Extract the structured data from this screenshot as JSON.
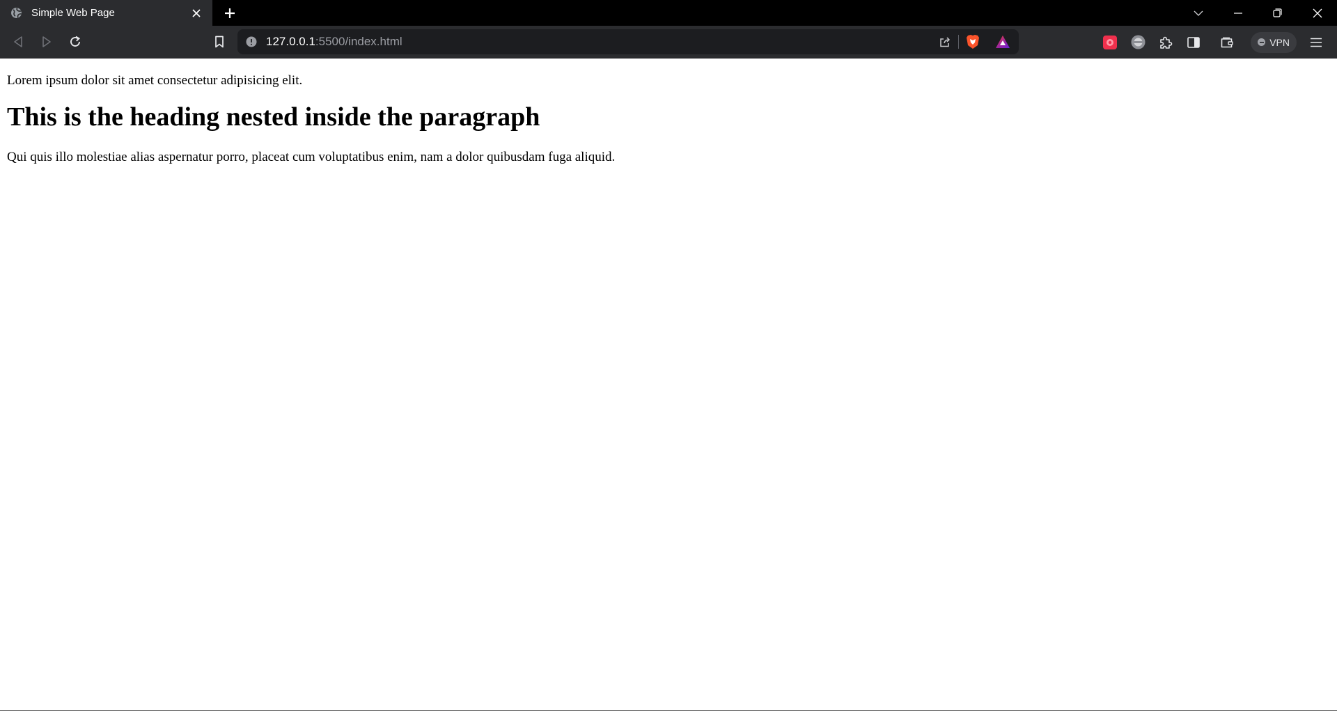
{
  "browser": {
    "tab": {
      "title": "Simple Web Page"
    },
    "address": {
      "host": "127.0.0.1",
      "path": ":5500/index.html"
    },
    "vpn_label": "VPN"
  },
  "page": {
    "paragraph_1": "Lorem ipsum dolor sit amet consectetur adipisicing elit.",
    "heading": "This is the heading nested inside the paragraph",
    "paragraph_2": "Qui quis illo molestiae alias aspernatur porro, placeat cum voluptatibus enim, nam a dolor quibusdam fuga aliquid."
  },
  "icons": {
    "tab_favicon": "globe-icon",
    "tab_close": "close-icon",
    "new_tab": "plus-icon",
    "tab_list": "chevron-down-icon",
    "minimize": "minimize-icon",
    "restore": "restore-icon",
    "close_window": "close-icon",
    "back": "back-arrow-icon",
    "forward": "forward-arrow-icon",
    "reload": "reload-icon",
    "bookmark": "bookmark-icon",
    "site_info": "info-icon",
    "share": "share-icon",
    "brave_shields": "brave-lion-icon",
    "brave_rewards": "rewards-triangle-icon",
    "extension_1": "extension-icon",
    "extension_2": "extension-icon",
    "extensions": "puzzle-icon",
    "sidebar": "sidebar-icon",
    "wallet": "wallet-icon",
    "menu": "hamburger-menu-icon"
  },
  "colors": {
    "tabbar_bg": "#000000",
    "toolbar_bg": "#2b2c2f",
    "omnibox_bg": "#1c1d20",
    "brave_orange": "#fb542b",
    "page_bg": "#ffffff"
  }
}
